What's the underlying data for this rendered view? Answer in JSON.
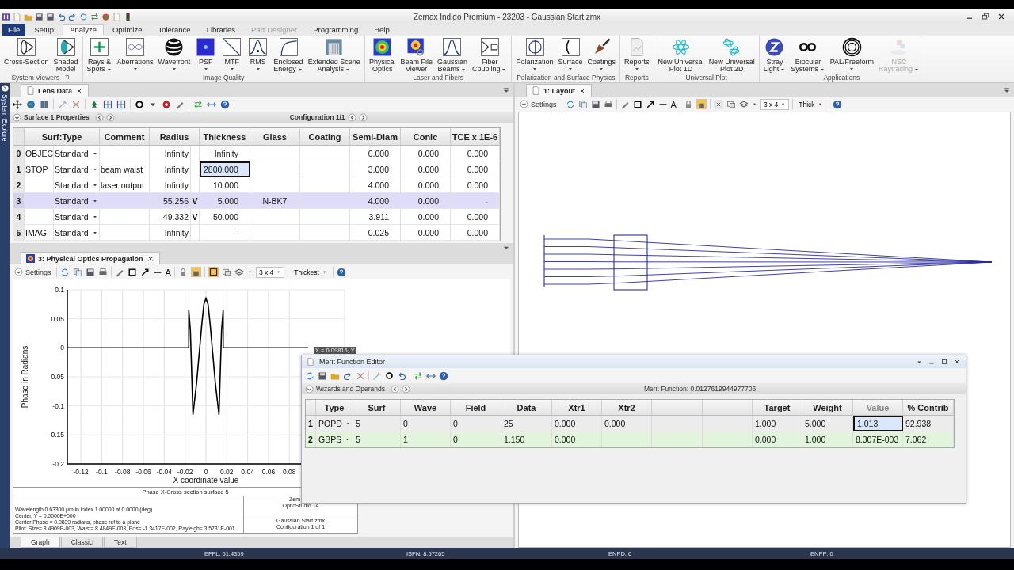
{
  "title_bar": {
    "title": "Zemax Indigo Premium - 23203 - Gaussian Start.zmx"
  },
  "menu_tabs": [
    {
      "label": "File",
      "kind": "file",
      "selected": false,
      "disabled": false
    },
    {
      "label": "Setup",
      "kind": "tab",
      "selected": false,
      "disabled": false
    },
    {
      "label": "Analyze",
      "kind": "tab",
      "selected": true,
      "disabled": false
    },
    {
      "label": "Optimize",
      "kind": "tab",
      "selected": false,
      "disabled": false
    },
    {
      "label": "Tolerance",
      "kind": "tab",
      "selected": false,
      "disabled": false
    },
    {
      "label": "Libraries",
      "kind": "tab",
      "selected": false,
      "disabled": false
    },
    {
      "label": "Part Designer",
      "kind": "tab",
      "selected": false,
      "disabled": true
    },
    {
      "label": "Programming",
      "kind": "tab",
      "selected": false,
      "disabled": false
    },
    {
      "label": "Help",
      "kind": "tab",
      "selected": false,
      "disabled": false
    }
  ],
  "ribbon": {
    "groups": [
      {
        "label": "System Viewers",
        "launcher": true,
        "items": [
          {
            "kind": "cross-section",
            "lines": [
              "Cross-Section"
            ],
            "dropdown": false,
            "disabled": false
          },
          {
            "kind": "shaded",
            "lines": [
              "Shaded",
              "Model"
            ],
            "dropdown": false,
            "disabled": false
          }
        ]
      },
      {
        "label": "Image Quality",
        "launcher": false,
        "items": [
          {
            "kind": "rays",
            "lines": [
              "Rays &",
              "Spots"
            ],
            "dropdown": true,
            "disabled": false
          },
          {
            "kind": "aberrations",
            "lines": [
              "Aberrations"
            ],
            "dropdown": true,
            "disabled": false
          },
          {
            "kind": "wavefront",
            "lines": [
              "Wavefront"
            ],
            "dropdown": true,
            "disabled": false
          },
          {
            "kind": "psf",
            "lines": [
              "PSF"
            ],
            "dropdown": true,
            "disabled": false
          },
          {
            "kind": "mtf",
            "lines": [
              "MTF"
            ],
            "dropdown": true,
            "disabled": false
          },
          {
            "kind": "rms",
            "lines": [
              "RMS"
            ],
            "dropdown": true,
            "disabled": false
          },
          {
            "kind": "enclosed",
            "lines": [
              "Enclosed",
              "Energy"
            ],
            "dropdown": true,
            "disabled": false
          },
          {
            "kind": "extended",
            "lines": [
              "Extended Scene",
              "Analysis"
            ],
            "dropdown": true,
            "disabled": false
          }
        ]
      },
      {
        "label": "Laser and Fibers",
        "launcher": false,
        "items": [
          {
            "kind": "physical",
            "lines": [
              "Physical",
              "Optics"
            ],
            "dropdown": false,
            "disabled": false
          },
          {
            "kind": "beamfile",
            "lines": [
              "Beam File",
              "Viewer"
            ],
            "dropdown": false,
            "disabled": false
          },
          {
            "kind": "gaussian",
            "lines": [
              "Gaussian",
              "Beams"
            ],
            "dropdown": true,
            "disabled": false
          },
          {
            "kind": "fiber",
            "lines": [
              "Fiber",
              "Coupling"
            ],
            "dropdown": true,
            "disabled": false
          }
        ]
      },
      {
        "label": "Polarization and Surface Physics",
        "launcher": false,
        "items": [
          {
            "kind": "polarization",
            "lines": [
              "Polarization"
            ],
            "dropdown": true,
            "disabled": false
          },
          {
            "kind": "surface",
            "lines": [
              "Surface"
            ],
            "dropdown": true,
            "disabled": false
          },
          {
            "kind": "coatings",
            "lines": [
              "Coatings"
            ],
            "dropdown": true,
            "disabled": false
          }
        ]
      },
      {
        "label": "Reports",
        "launcher": false,
        "items": [
          {
            "kind": "reports",
            "lines": [
              "Reports"
            ],
            "dropdown": true,
            "disabled": false
          }
        ]
      },
      {
        "label": "Universal Plot",
        "launcher": false,
        "items": [
          {
            "kind": "universal1d",
            "lines": [
              "New Universal",
              "Plot 1D"
            ],
            "dropdown": false,
            "disabled": false
          },
          {
            "kind": "universal2d",
            "lines": [
              "New Universal",
              "Plot 2D"
            ],
            "dropdown": false,
            "disabled": false
          }
        ]
      },
      {
        "label": "Applications",
        "launcher": false,
        "items": [
          {
            "kind": "stray",
            "lines": [
              "Stray",
              "Light"
            ],
            "dropdown": true,
            "disabled": false
          },
          {
            "kind": "biocular",
            "lines": [
              "Biocular",
              "Systems"
            ],
            "dropdown": true,
            "disabled": false
          },
          {
            "kind": "freeform",
            "lines": [
              "PAL/Freeform"
            ],
            "dropdown": true,
            "disabled": false
          },
          {
            "kind": "nsc",
            "lines": [
              "NSC",
              "Raytracing"
            ],
            "dropdown": true,
            "disabled": true
          }
        ]
      }
    ]
  },
  "sidebar": {
    "label": "System Explorer"
  },
  "lens_data": {
    "tab": "Lens Data",
    "properties_label": "Surface 1 Properties",
    "configuration": "Configuration 1/1",
    "columns": [
      "Surf:Type",
      "Comment",
      "Radius",
      "Thickness",
      "Glass",
      "Coating",
      "Semi-Diam",
      "Conic",
      "TCE x 1E-6"
    ],
    "rows": [
      {
        "num": "0",
        "surface": "OBJEC",
        "type": "Standard",
        "radius": "Infinity",
        "thickness": "Infinity",
        "semi_diam": "0.000",
        "conic": "0.000",
        "tce": "0.000",
        "selected": false,
        "thickness_focused": false
      },
      {
        "num": "1",
        "surface": "STOP",
        "type": "Standard",
        "comment": "beam waist",
        "radius": "Infinity",
        "thickness": "2800.000",
        "semi_diam": "3.000",
        "conic": "0.000",
        "tce": "0.000",
        "selected": false,
        "thickness_focused": true
      },
      {
        "num": "2",
        "type": "Standard",
        "comment": "laser output",
        "radius": "Infinity",
        "thickness": "10.000",
        "semi_diam": "4.000",
        "conic": "0.000",
        "tce": "0.000",
        "selected": false,
        "thickness_focused": false
      },
      {
        "num": "3",
        "type": "Standard",
        "radius": "55.256",
        "radius_solve": "V",
        "thickness": "5.000",
        "glass": "N-BK7",
        "semi_diam": "4.000",
        "conic": "0.000",
        "tce": "-",
        "selected": true,
        "thickness_focused": false
      },
      {
        "num": "4",
        "type": "Standard",
        "radius": "-49.332",
        "radius_solve": "V",
        "thickness": "50.000",
        "semi_diam": "3.911",
        "conic": "0.000",
        "tce": "0.000",
        "selected": false,
        "thickness_focused": false
      },
      {
        "num": "5",
        "surface": "IMAG",
        "type": "Standard",
        "radius": "Infinity",
        "thickness": "-",
        "semi_diam": "0.025",
        "conic": "0.000",
        "tce": "0.000",
        "selected": false,
        "thickness_focused": false
      }
    ]
  },
  "pop_window": {
    "tab": "3: Physical Optics Propagation",
    "toolbar": {
      "settings": "Settings",
      "text_tool": "A",
      "layout_choice": "3 x 4",
      "line_choice": "Thickest"
    },
    "chart_data": {
      "type": "line",
      "xlabel": "X coordinate value",
      "ylabel": "Phase in Radians",
      "x": [
        -0.133,
        -0.0165,
        -0.0165,
        -0.015,
        -0.0125,
        -0.009,
        -0.004,
        -0.002,
        0,
        0.002,
        0.004,
        0.009,
        0.0125,
        0.015,
        0.0165,
        0.0165,
        0.098
      ],
      "series": [
        {
          "color": "#000000",
          "values": [
            0,
            0,
            0.065,
            0.03,
            -0.115,
            -0.06,
            0.04,
            0.075,
            0.085,
            0.075,
            0.04,
            -0.06,
            -0.115,
            0.03,
            0.065,
            0,
            0
          ]
        }
      ],
      "grid": true,
      "xlim": [
        -0.133,
        0.133
      ],
      "ylim": [
        -0.2,
        0.1
      ],
      "xticks": [
        -0.12,
        -0.1,
        -0.08,
        -0.06,
        -0.04,
        -0.02,
        0,
        0.02,
        0.04,
        0.06,
        0.08
      ],
      "yticks": [
        0.1,
        0.05,
        0,
        {
          "value": -0.05,
          "label": "0.05"
        },
        -0.1,
        -0.15,
        -0.2
      ]
    },
    "cursor_readout": "X = 0.09816, Y",
    "plot_title": "Phase X-Cross section surface 5",
    "info_lines": [
      "Wavelength 0.63300 µm in index 1.00000 at 0.0000 (deg)",
      "Center, Y = 0.0000E+000",
      "Center Phase = 0.0839 radians, phase ref to a plane",
      "Pilot: Size= 8.4909E-003, Waist= 8.4849E-003, Pos= -1.3417E-002, Rayleigh= 3.5731E-001"
    ],
    "program_lines": [
      "Zem",
      "OpticStudio 14"
    ],
    "file_lines": [
      "Gaussian Start.zmx",
      "Configuration 1 of 1"
    ],
    "view_tabs": [
      {
        "label": "Graph",
        "selected": true
      },
      {
        "label": "Classic",
        "selected": false
      },
      {
        "label": "Text",
        "selected": false
      }
    ]
  },
  "layout_window": {
    "tab": "1: Layout",
    "toolbar": {
      "settings": "Settings",
      "text_tool": "A",
      "layout_choice": "3 x 4",
      "line_choice": "Thick"
    }
  },
  "merit_editor": {
    "title": "Merit Function Editor",
    "section": "Wizards and Operands",
    "merit_value": "Merit Function: 0.0127619944977706",
    "columns": [
      {
        "label": "Type",
        "readonly": false
      },
      {
        "label": "Surf",
        "readonly": false
      },
      {
        "label": "Wave",
        "readonly": false
      },
      {
        "label": "Field",
        "readonly": false
      },
      {
        "label": "Data",
        "readonly": false
      },
      {
        "label": "Xtr1",
        "readonly": false
      },
      {
        "label": "Xtr2",
        "readonly": false
      },
      {
        "label": "Target",
        "readonly": false
      },
      {
        "label": "Weight",
        "readonly": false
      },
      {
        "label": "Value",
        "readonly": true
      },
      {
        "label": "% Contrib",
        "readonly": false
      }
    ],
    "rows": [
      {
        "num": "1",
        "type": "POPD",
        "surf": "5",
        "wave": "0",
        "field": "0",
        "data": "25",
        "xtr1": "0.000",
        "xtr2": "0.000",
        "target": "1.000",
        "weight": "5.000",
        "value": "1.013",
        "contrib": "92.938",
        "selected": false,
        "value_focused": true
      },
      {
        "num": "2",
        "type": "GBPS",
        "surf": "5",
        "wave": "1",
        "field": "0",
        "data": "1.150",
        "xtr1": "0.000",
        "target": "0.000",
        "weight": "1.000",
        "value": "8.307E-003",
        "contrib": "7.062",
        "selected": true,
        "value_focused": false
      }
    ]
  },
  "status_bar": [
    "EFFL: 51.4359",
    "ISFN: 8.57265",
    "ENPD: 6",
    "ENPP: 0"
  ]
}
